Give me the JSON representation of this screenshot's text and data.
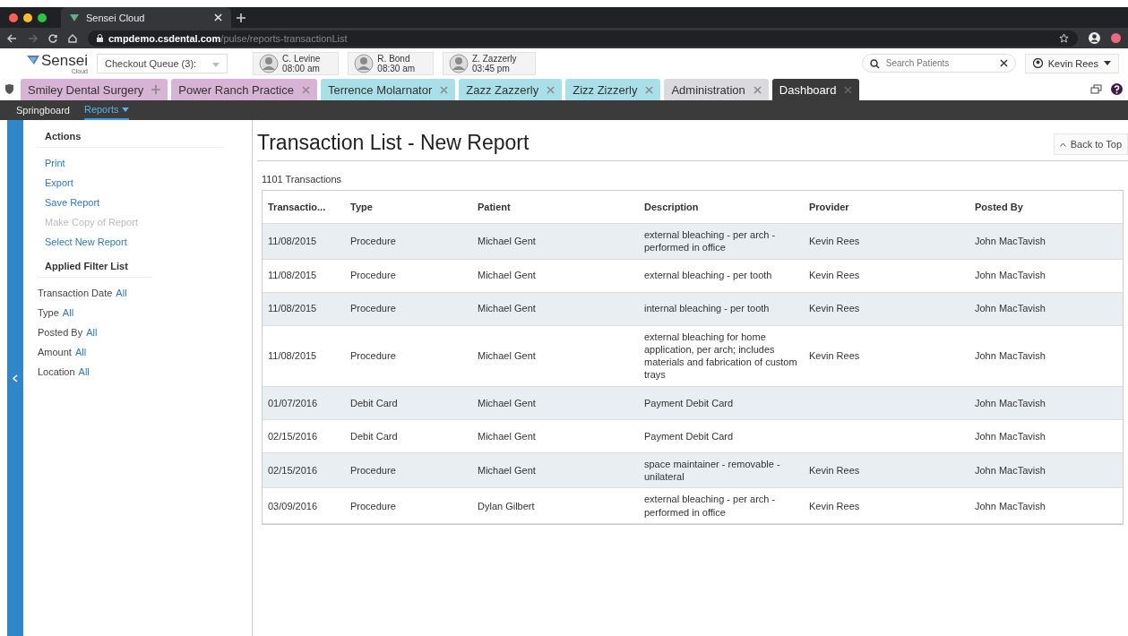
{
  "browser": {
    "tab_title": "Sensei Cloud",
    "url_host": "cmpdemo.csdental.com",
    "url_path": "/pulse/reports-transactionList"
  },
  "header": {
    "logo": "Sensei",
    "logo_sub": "Cloud",
    "checkout_queue": "Checkout Queue (3):",
    "appointments": [
      {
        "name": "C. Levine",
        "time": "08:00 am"
      },
      {
        "name": "R. Bond",
        "time": "08:30 am"
      },
      {
        "name": "Z. Zazzerly",
        "time": "03:45 pm"
      }
    ],
    "search": {
      "placeholder": "Search Patients"
    },
    "user": "Kevin Rees"
  },
  "tabs": [
    {
      "label": "Smiley Dental Surgery",
      "kind": "pinned",
      "color": "#d7b4d6",
      "selected": false
    },
    {
      "label": "Power Ranch Practice",
      "kind": "closable",
      "color": "#d7b4d6",
      "selected": false
    },
    {
      "label": "Terrence Molarnator",
      "kind": "closable",
      "color": "#a9dfe8",
      "selected": false
    },
    {
      "label": "Zazz Zazzerly",
      "kind": "closable",
      "color": "#a9dfe8",
      "selected": false
    },
    {
      "label": "Zizz Zizzerly",
      "kind": "closable",
      "color": "#a9dfe8",
      "selected": false
    },
    {
      "label": "Administration",
      "kind": "closable",
      "color": "#d9d9de",
      "selected": false
    },
    {
      "label": "Dashboard",
      "kind": "closable",
      "color": "#3a3a3a",
      "selected": true
    }
  ],
  "nav": [
    {
      "label": "Springboard",
      "selected": false,
      "dropdown": false
    },
    {
      "label": "Reports",
      "selected": true,
      "dropdown": true
    }
  ],
  "sidebar": {
    "actions_title": "Actions",
    "actions": [
      {
        "label": "Print",
        "disabled": false
      },
      {
        "label": "Export",
        "disabled": false
      },
      {
        "label": "Save Report",
        "disabled": false
      },
      {
        "label": "Make Copy of Report",
        "disabled": true
      },
      {
        "label": "Select New Report",
        "disabled": false
      }
    ],
    "filters_title": "Applied Filter List",
    "filters": [
      {
        "label": "Transaction Date",
        "value": "All"
      },
      {
        "label": "Type",
        "value": "All"
      },
      {
        "label": "Posted By",
        "value": "All"
      },
      {
        "label": "Amount",
        "value": "All"
      },
      {
        "label": "Location",
        "value": "All"
      }
    ]
  },
  "report": {
    "title": "Transaction List - New Report",
    "back_to_top": "Back to Top",
    "count": "1101 Transactions",
    "table": {
      "columns": [
        "Transactio...",
        "Type",
        "Patient",
        "Description",
        "Provider",
        "Posted By"
      ],
      "rows": [
        [
          "11/08/2015",
          "Procedure",
          "Michael Gent",
          "external bleaching - per arch - performed in office",
          "Kevin Rees",
          "John MacTavish"
        ],
        [
          "11/08/2015",
          "Procedure",
          "Michael Gent",
          "external bleaching - per tooth",
          "Kevin Rees",
          "John MacTavish"
        ],
        [
          "11/08/2015",
          "Procedure",
          "Michael Gent",
          "internal bleaching - per tooth",
          "Kevin Rees",
          "John MacTavish"
        ],
        [
          "11/08/2015",
          "Procedure",
          "Michael Gent",
          "external bleaching for home application, per arch; includes materials and fabrication of custom trays",
          "Kevin Rees",
          "John MacTavish"
        ],
        [
          "01/07/2016",
          "Debit Card",
          "Michael Gent",
          "Payment Debit Card",
          "",
          "John MacTavish"
        ],
        [
          "02/15/2016",
          "Debit Card",
          "Michael Gent",
          "Payment Debit Card",
          "",
          "John MacTavish"
        ],
        [
          "02/15/2016",
          "Procedure",
          "Michael Gent",
          "space maintainer - removable - unilateral",
          "Kevin Rees",
          "John MacTavish"
        ],
        [
          "03/09/2016",
          "Procedure",
          "Dylan Gilbert",
          "external bleaching - per arch - performed in office",
          "Kevin Rees",
          "John MacTavish"
        ]
      ]
    }
  }
}
